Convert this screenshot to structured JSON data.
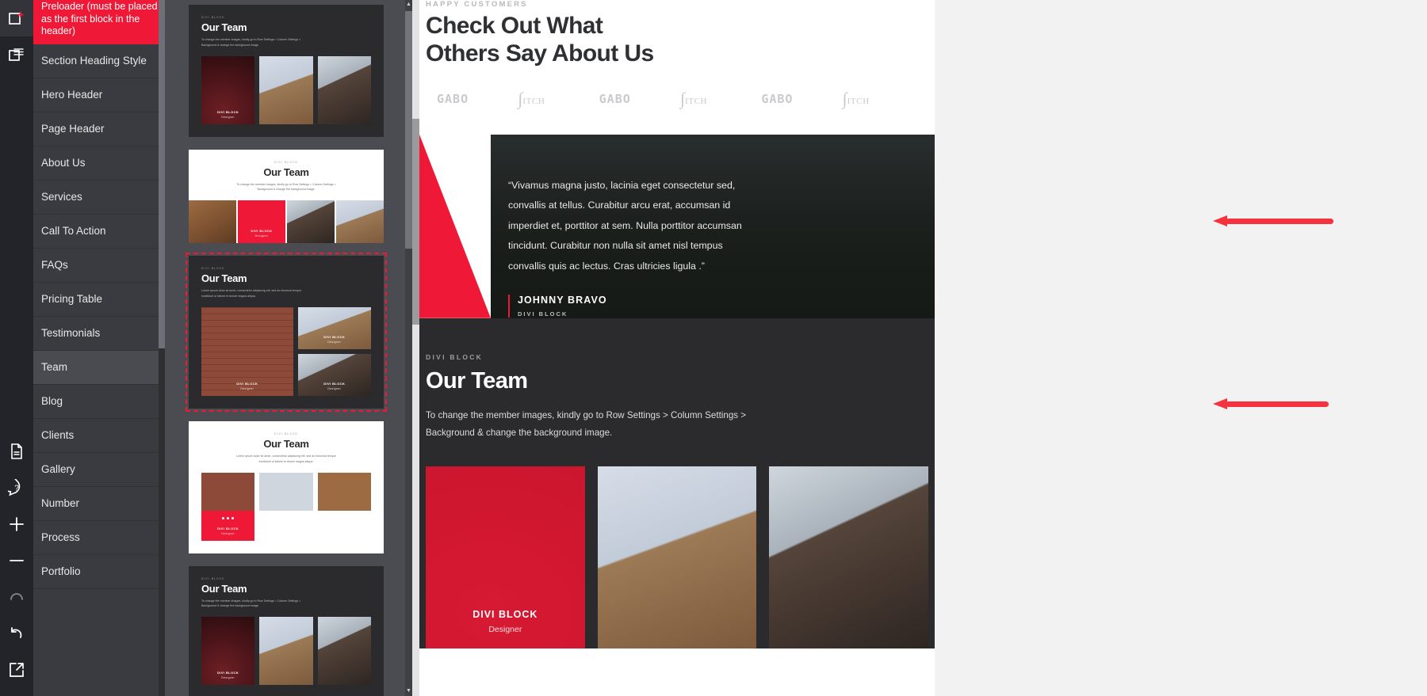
{
  "rail": {
    "items": [
      {
        "name": "add-block-icon",
        "label": "Add Block"
      },
      {
        "name": "layers-icon",
        "label": "Layers"
      },
      {
        "name": "document-icon",
        "label": "Document"
      },
      {
        "name": "help-icon",
        "label": "Help"
      },
      {
        "name": "zoom-in-icon",
        "label": "Zoom In"
      },
      {
        "name": "zoom-out-icon",
        "label": "Zoom Out"
      },
      {
        "name": "redo-icon",
        "label": "Redo"
      },
      {
        "name": "undo-icon",
        "label": "Undo"
      },
      {
        "name": "external-link-icon",
        "label": "Open"
      }
    ]
  },
  "sidebar": {
    "notice": "Preloader (must be placed as the first block in the header)",
    "items": [
      {
        "label": "Section Heading Style",
        "selected": false
      },
      {
        "label": "Hero Header",
        "selected": false
      },
      {
        "label": "Page Header",
        "selected": false
      },
      {
        "label": "About Us",
        "selected": false
      },
      {
        "label": "Services",
        "selected": false
      },
      {
        "label": "Call To Action",
        "selected": false
      },
      {
        "label": "FAQs",
        "selected": false
      },
      {
        "label": "Pricing Table",
        "selected": false
      },
      {
        "label": "Testimonials",
        "selected": false
      },
      {
        "label": "Team",
        "selected": true
      },
      {
        "label": "Blog",
        "selected": false
      },
      {
        "label": "Clients",
        "selected": false
      },
      {
        "label": "Gallery",
        "selected": false
      },
      {
        "label": "Number",
        "selected": false
      },
      {
        "label": "Process",
        "selected": false
      },
      {
        "label": "Portfolio",
        "selected": false
      }
    ]
  },
  "thumbnails": {
    "eyebrow": "DIVI BLOCK",
    "title": "Our Team",
    "desc_short": "To change the member images, kindly go to Row Settings > Column Settings >",
    "desc_short2": "Background & change the background image.",
    "desc_alt": "Lorem ipsum dolor sit amet, consectetur adipiscing elit, sed do eiusmod tempor",
    "desc_alt2": "incididunt ut labore et dolore magna aliqua.",
    "card_label": "DIVI BLOCK",
    "card_role": "Designer",
    "items": [
      {
        "id": 1,
        "theme": "dark",
        "layout": "three-up",
        "selected": false
      },
      {
        "id": 2,
        "theme": "light",
        "layout": "centered-strip",
        "selected": false
      },
      {
        "id": 3,
        "theme": "dark",
        "layout": "mosaic",
        "selected": true
      },
      {
        "id": 4,
        "theme": "light",
        "layout": "cards-dots",
        "selected": false
      },
      {
        "id": 5,
        "theme": "dark",
        "layout": "three-up",
        "selected": false
      }
    ]
  },
  "preview": {
    "hero": {
      "eyebrow": "HAPPY CUSTOMERS",
      "title_line1": "Check Out What",
      "title_line2": "Others Say About Us"
    },
    "clients": [
      {
        "type": "gabo",
        "text": "GABO"
      },
      {
        "type": "pitch",
        "text": "ITCH"
      },
      {
        "type": "gabo",
        "text": "GABO"
      },
      {
        "type": "pitch",
        "text": "ITCH"
      },
      {
        "type": "gabo",
        "text": "GABO"
      },
      {
        "type": "pitch",
        "text": "ITCH"
      }
    ],
    "testimonial": {
      "quote": "“Vivamus magna justo, lacinia eget consectetur sed, convallis at tellus. Curabitur arcu erat, accumsan id imperdiet et, porttitor at sem. Nulla porttitor accumsan tincidunt. Curabitur non nulla sit amet nisl tempus convallis quis ac lectus. Cras ultricies ligula .”",
      "author": "JOHNNY BRAVO",
      "role": "DIVI BLOCK"
    },
    "team": {
      "eyebrow": "DIVI BLOCK",
      "title": "Our Team",
      "desc_line1": "To change the member images, kindly go to Row Settings > Column Settings >",
      "desc_line2": "Background & change the background image.",
      "members": [
        {
          "name": "DIVI BLOCK",
          "role": "Designer",
          "highlight": true
        },
        {
          "name": "",
          "role": "",
          "highlight": false
        },
        {
          "name": "",
          "role": "",
          "highlight": false
        }
      ]
    }
  },
  "annotations": {
    "arrows": [
      {
        "name": "annotation-arrow-top"
      },
      {
        "name": "annotation-arrow-bottom"
      }
    ],
    "color_swatch": "#e8172f"
  }
}
